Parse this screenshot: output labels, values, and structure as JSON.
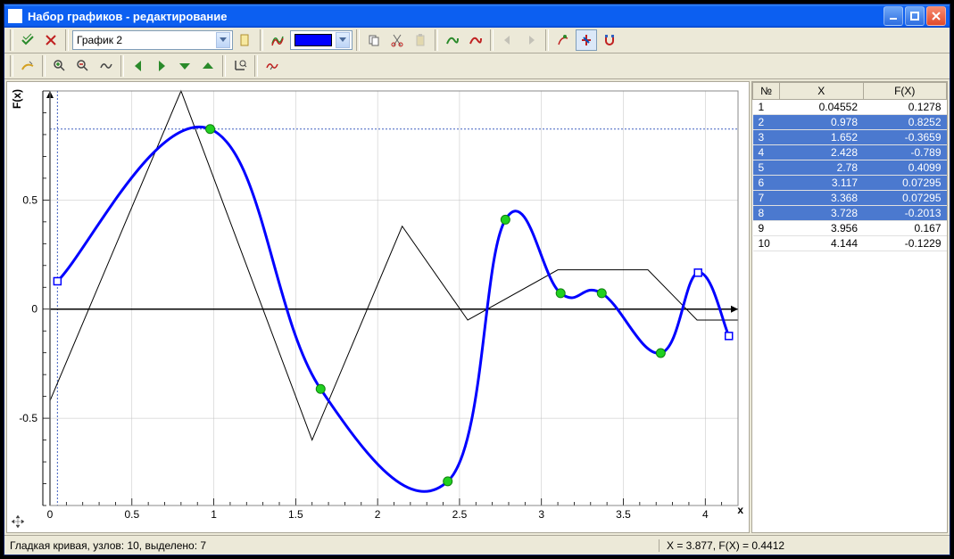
{
  "window": {
    "title": "Набор графиков - редактирование"
  },
  "toolbar1": {
    "graph_selector": "График 2",
    "color": "#0000ff"
  },
  "data_table": {
    "headers": {
      "num": "№",
      "x": "X",
      "fx": "F(X)"
    },
    "rows": [
      {
        "n": "1",
        "x": "0.04552",
        "fx": "0.1278",
        "selected": false
      },
      {
        "n": "2",
        "x": "0.978",
        "fx": "0.8252",
        "selected": true
      },
      {
        "n": "3",
        "x": "1.652",
        "fx": "-0.3659",
        "selected": true
      },
      {
        "n": "4",
        "x": "2.428",
        "fx": "-0.789",
        "selected": true
      },
      {
        "n": "5",
        "x": "2.78",
        "fx": "0.4099",
        "selected": true
      },
      {
        "n": "6",
        "x": "3.117",
        "fx": "0.07295",
        "selected": true
      },
      {
        "n": "7",
        "x": "3.368",
        "fx": "0.07295",
        "selected": true
      },
      {
        "n": "8",
        "x": "3.728",
        "fx": "-0.2013",
        "selected": true
      },
      {
        "n": "9",
        "x": "3.956",
        "fx": "0.167",
        "selected": false
      },
      {
        "n": "10",
        "x": "4.144",
        "fx": "-0.1229",
        "selected": false
      }
    ]
  },
  "chart_data": {
    "type": "line",
    "xlabel": "x",
    "ylabel": "F(x)",
    "xlim": [
      0,
      4.2
    ],
    "ylim": [
      -0.9,
      1.0
    ],
    "xticks": [
      0,
      0.5,
      1,
      1.5,
      2,
      2.5,
      3,
      3.5,
      4
    ],
    "yticks": [
      -0.5,
      0,
      0.5
    ],
    "guidelines": {
      "x": 0.04552,
      "y": 0.8252
    },
    "series": [
      {
        "name": "smooth-curve",
        "color": "#0000ff",
        "width": 3,
        "kind": "nodes",
        "values": [
          [
            0.04552,
            0.1278
          ],
          [
            0.978,
            0.8252
          ],
          [
            1.652,
            -0.3659
          ],
          [
            2.428,
            -0.789
          ],
          [
            2.78,
            0.4099
          ],
          [
            3.117,
            0.07295
          ],
          [
            3.368,
            0.07295
          ],
          [
            3.728,
            -0.2013
          ],
          [
            3.956,
            0.167
          ],
          [
            4.144,
            -0.1229
          ]
        ],
        "selected_indices": [
          1,
          2,
          3,
          4,
          5,
          6,
          7
        ]
      },
      {
        "name": "polyline-black",
        "color": "#000000",
        "width": 1,
        "kind": "polyline",
        "values": [
          [
            0,
            -0.42
          ],
          [
            0.8,
            1.0
          ],
          [
            1.6,
            -0.6
          ],
          [
            2.15,
            0.38
          ],
          [
            2.55,
            -0.05
          ],
          [
            3.1,
            0.18
          ],
          [
            3.65,
            0.18
          ],
          [
            3.95,
            -0.05
          ],
          [
            4.2,
            -0.05
          ]
        ]
      }
    ]
  },
  "status": {
    "left": "Гладкая кривая, узлов: 10, выделено: 7",
    "right": "X = 3.877, F(X) = 0.4412"
  }
}
